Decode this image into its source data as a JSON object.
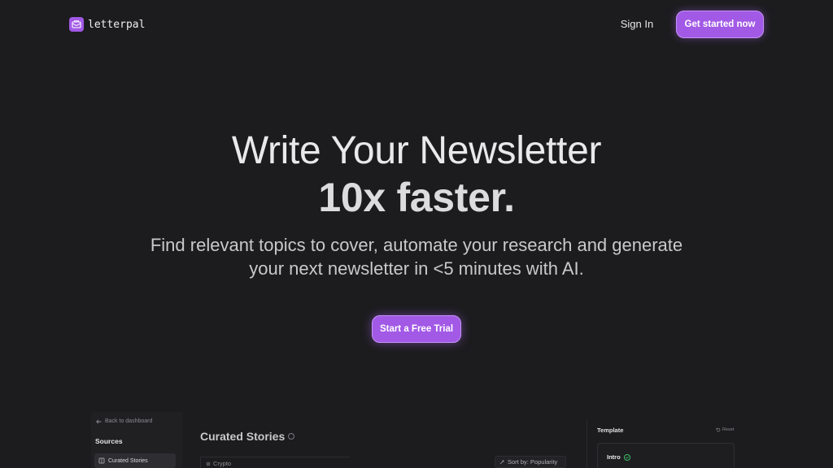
{
  "header": {
    "logo_text": "letterpal",
    "signin_label": "Sign In",
    "cta_label": "Get started now"
  },
  "hero": {
    "title_line1": "Write Your Newsletter",
    "title_line2": "10x faster.",
    "subtitle": "Find relevant topics to cover, automate your research and generate your next newsletter in <5 minutes with AI.",
    "cta_label": "Start a Free Trial"
  },
  "preview": {
    "back_label": "Back to dashboard",
    "sidebar_heading": "Sources",
    "sidebar_items": [
      {
        "label": "Curated Stories",
        "icon": "book-icon"
      }
    ],
    "main_title": "Curated Stories",
    "filter_label": "Crypto",
    "sort_label": "Sort by: Popularity",
    "template_heading": "Template",
    "reset_label": "Reset",
    "intro_label": "Intro"
  },
  "colors": {
    "background": "#1c1c1e",
    "accent": "#a259e6",
    "accent_border": "#c592f5",
    "success": "#3fbf6a"
  }
}
